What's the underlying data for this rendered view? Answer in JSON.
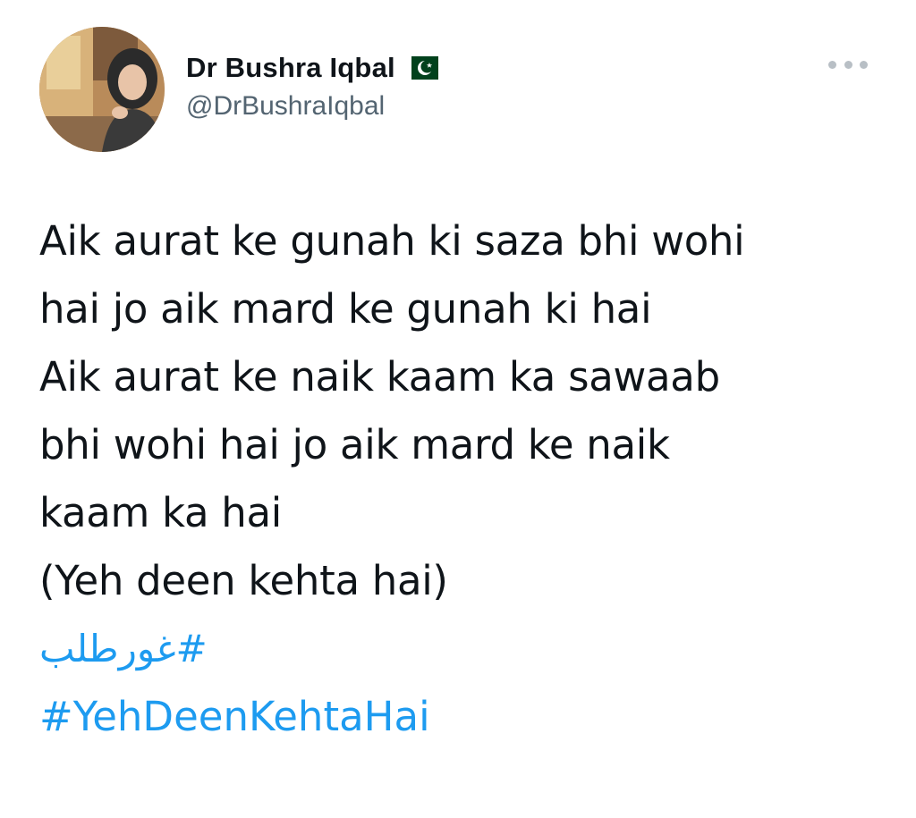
{
  "tweet": {
    "author": {
      "display_name": "Dr Bushra Iqbal",
      "flag_icon": "pakistan-flag-icon",
      "handle": "@DrBushraIqbal"
    },
    "more_icon": "more-options-icon",
    "lines": [
      "Aik aurat ke gunah ki saza bhi wohi",
      "hai jo aik mard ke gunah ki hai",
      "Aik aurat ke naik kaam ka sawaab",
      "bhi wohi hai jo aik mard ke naik",
      "kaam ka hai",
      "(Yeh deen kehta hai)"
    ],
    "hashtags": [
      "#غورطلب",
      "#YehDeenKehtaHai"
    ]
  },
  "colors": {
    "text": "#0f1419",
    "secondary_text": "#536471",
    "link": "#1d9bf0",
    "flag_green": "#01411c"
  }
}
